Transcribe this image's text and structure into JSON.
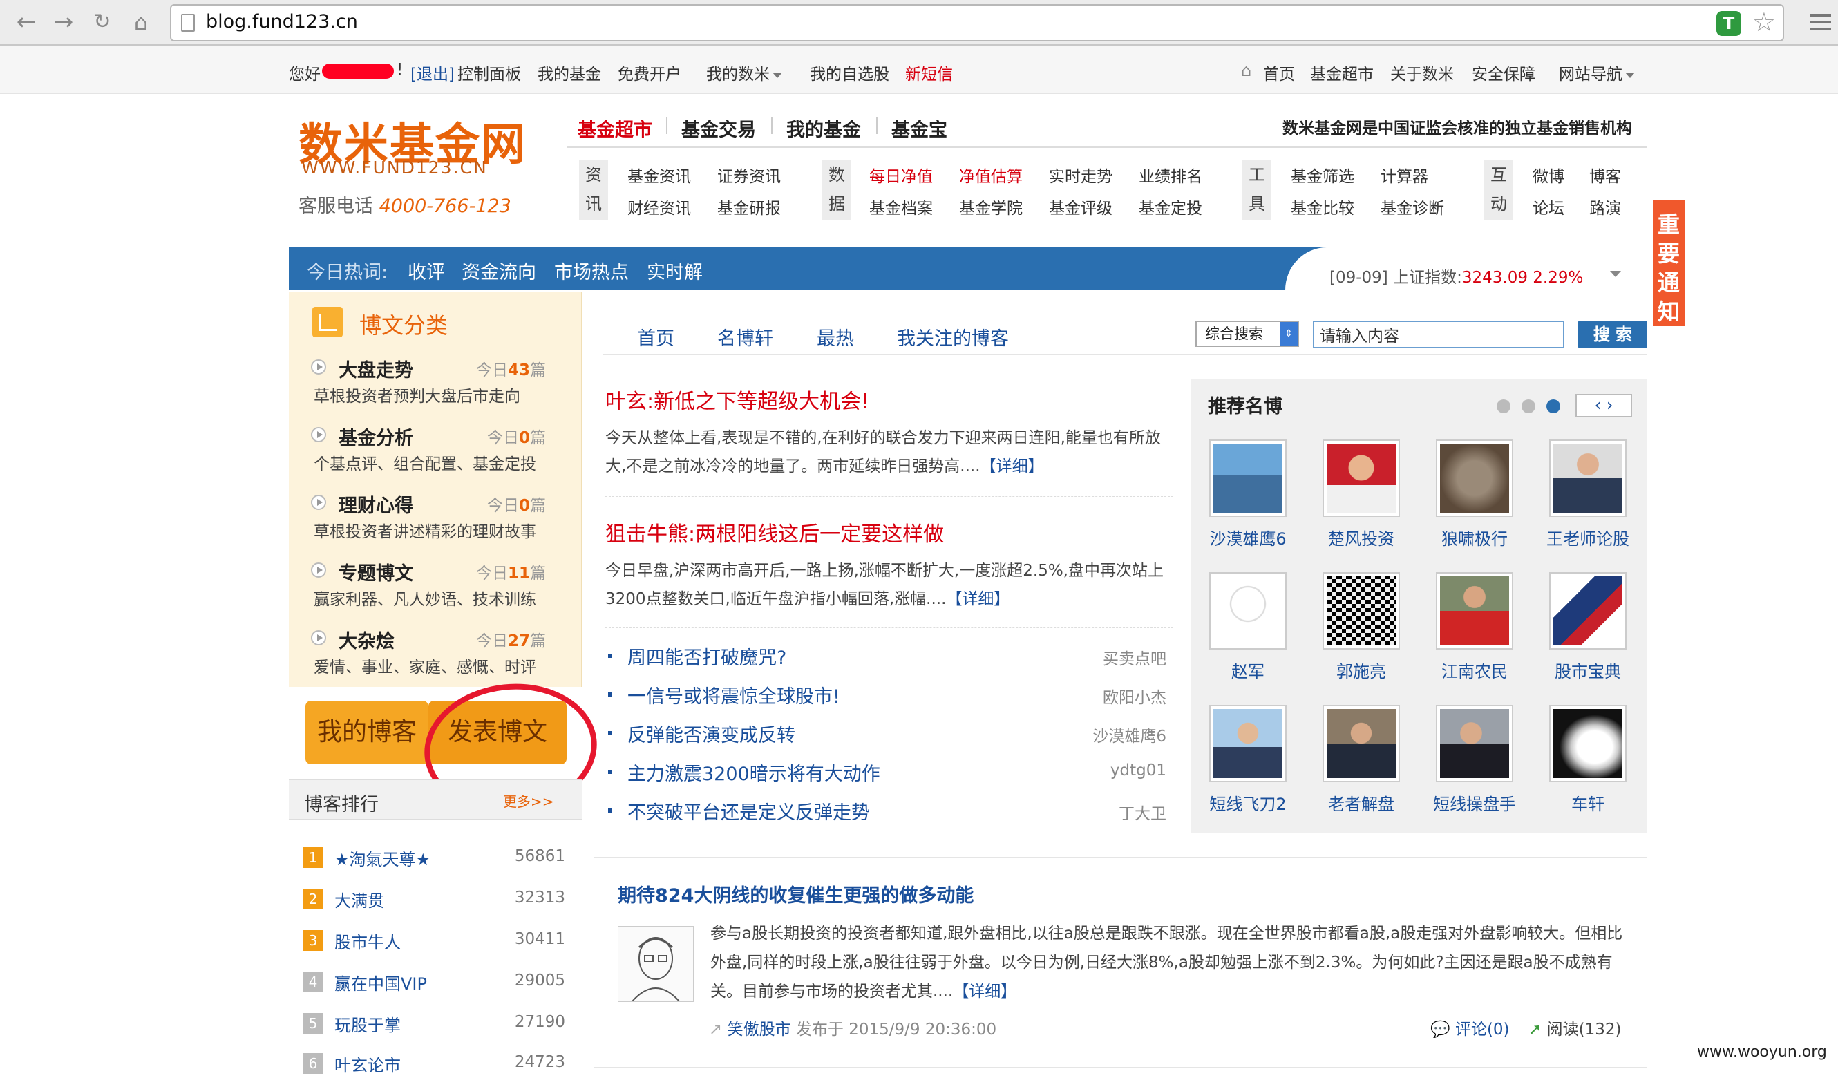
{
  "browser": {
    "url": "blog.fund123.cn",
    "extension_badge": "T"
  },
  "topbar": {
    "greeting": "您好",
    "exclaim": "!",
    "logout": "[退出]",
    "left_links": [
      "控制面板",
      "我的基金",
      "免费开户"
    ],
    "shumi": "我的数米",
    "watchlist": "我的自选股",
    "new_msg": "新短信",
    "right_links": [
      "首页",
      "基金超市",
      "关于数米",
      "安全保障"
    ],
    "site_nav": "网站导航"
  },
  "header": {
    "logo_cn": "数米基金网",
    "logo_en": "WWW.FUND123.CN",
    "service_label": "客服电话",
    "service_number": "4000-766-123",
    "main_nav": [
      "基金超市",
      "基金交易",
      "我的基金",
      "基金宝"
    ],
    "slogan": "数米基金网是中国证监会核准的独立基金销售机构",
    "groups": [
      {
        "label": "资讯",
        "links": [
          "基金资讯",
          "证券资讯",
          "财经资讯",
          "基金研报"
        ]
      },
      {
        "label": "数据",
        "links": [
          "每日净值",
          "净值估算",
          "实时走势",
          "业绩排名",
          "基金档案",
          "基金学院",
          "基金评级",
          "基金定投"
        ]
      },
      {
        "label": "工具",
        "links": [
          "基金筛选",
          "计算器",
          "基金比较",
          "基金诊断"
        ]
      },
      {
        "label": "互动",
        "links": [
          "微博",
          "博客",
          "论坛",
          "路演"
        ]
      }
    ]
  },
  "hotbar": {
    "label": "今日热词:",
    "words": [
      "收评",
      "资金流向",
      "市场热点",
      "实时解"
    ],
    "index_date": "[09-09] 上证指数:",
    "index_value": "3243.09 2.29%"
  },
  "notice": "重要通知",
  "sidebar": {
    "title": "博文分类",
    "categories": [
      {
        "name": "大盘走势",
        "today_prefix": "今日",
        "count": "43",
        "unit": "篇",
        "desc": "草根投资者预判大盘后市走向"
      },
      {
        "name": "基金分析",
        "today_prefix": "今日",
        "count": "0",
        "unit": "篇",
        "desc": "个基点评、组合配置、基金定投"
      },
      {
        "name": "理财心得",
        "today_prefix": "今日",
        "count": "0",
        "unit": "篇",
        "desc": "草根投资者讲述精彩的理财故事"
      },
      {
        "name": "专题博文",
        "today_prefix": "今日",
        "count": "11",
        "unit": "篇",
        "desc": "赢家利器、凡人妙语、技术训练"
      },
      {
        "name": "大杂烩",
        "today_prefix": "今日",
        "count": "27",
        "unit": "篇",
        "desc": "爱情、事业、家庭、感慨、时评"
      }
    ],
    "my_blog": "我的博客",
    "post_blog": "发表博文",
    "rank_title": "博客排行",
    "rank_more": "更多>>",
    "ranking": [
      {
        "num": "1",
        "name": "★淘氣天尊★",
        "value": "56861"
      },
      {
        "num": "2",
        "name": "大满贯",
        "value": "32313"
      },
      {
        "num": "3",
        "name": "股市牛人",
        "value": "30411"
      },
      {
        "num": "4",
        "name": "赢在中国VIP",
        "value": "29005"
      },
      {
        "num": "5",
        "name": "玩股于掌",
        "value": "27190"
      },
      {
        "num": "6",
        "name": "叶玄论市",
        "value": "24723"
      }
    ]
  },
  "content": {
    "tabs": [
      "首页",
      "名博轩",
      "最热",
      "我关注的博客"
    ],
    "search_select": "综合搜索",
    "search_placeholder": "请输入内容",
    "search_button": "搜 索",
    "featured": [
      {
        "title": "叶玄:新低之下等超级大机会!",
        "text": "今天从整体上看,表现是不错的,在利好的联合发力下迎来两日连阳,能量也有所放大,不是之前冰冷冷的地量了。两市延续昨日强势高....",
        "more": "【详细】"
      },
      {
        "title": "狙击牛熊:两根阳线这后一定要这样做",
        "text": "今日早盘,沪深两市高开后,一路上扬,涨幅不断扩大,一度涨超2.5%,盘中再次站上3200点整数关口,临近午盘沪指小幅回落,涨幅....",
        "more": "【详细】"
      }
    ],
    "list": [
      {
        "title": "周四能否打破魔咒?",
        "author": "买卖点吧"
      },
      {
        "title": "一信号或将震惊全球股市!",
        "author": "欧阳小杰"
      },
      {
        "title": "反弹能否演变成反转",
        "author": "沙漠雄鹰6"
      },
      {
        "title": "主力激震3200暗示将有大动作",
        "author": "ydtg01"
      },
      {
        "title": "不突破平台还是定义反弹走势",
        "author": "丁大卫"
      }
    ]
  },
  "recommend": {
    "title": "推荐名博",
    "bloggers": [
      "沙漠雄鹰6",
      "楚风投资",
      "狼啸极行",
      "王老师论股",
      "赵军",
      "郭施亮",
      "江南农民",
      "股市宝典",
      "短线飞刀2",
      "老者解盘",
      "短线操盘手",
      "车轩"
    ]
  },
  "bottom_post": {
    "title": "期待824大阴线的收复催生更强的做多动能",
    "text": "参与a股长期投资的投资者都知道,跟外盘相比,以往a股总是跟跌不跟涨。现在全世界股市都看a股,a股走强对外盘影响较大。但相比外盘,同样的时段上涨,a股往往弱于外盘。以今日为例,日经大涨8%,a股却勉强上涨不到2.3%。为何如此?主因还是跟a股不成熟有关。目前参与市场的投资者尤其....",
    "more": "【详细】",
    "author": "笑傲股市",
    "published": "发布于 2015/9/9 20:36:00",
    "comments": "评论(0)",
    "reads": "阅读(132)"
  },
  "watermark": "www.wooyun.org",
  "colors": {
    "brand_orange": "#e8630a",
    "link_blue": "#1a4f9b",
    "hot_red": "#d7000f",
    "bar_blue": "#2a6fb0"
  }
}
